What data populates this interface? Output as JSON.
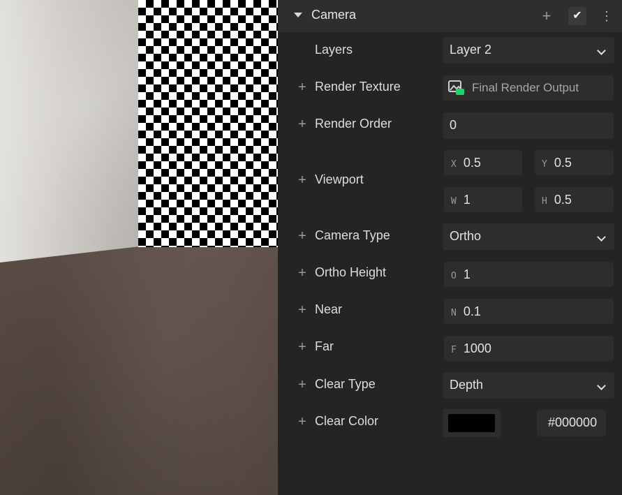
{
  "panel": {
    "title": "Camera",
    "header_plus": "+",
    "header_check": "✔",
    "header_more": "⋮",
    "fields": {
      "layers": {
        "label": "Layers",
        "value": "Layer 2"
      },
      "render_texture": {
        "label": "Render Texture",
        "value": "Final Render Output"
      },
      "render_order": {
        "label": "Render Order",
        "value": "0"
      },
      "viewport": {
        "label": "Viewport",
        "x": {
          "prefix": "X",
          "value": "0.5"
        },
        "y": {
          "prefix": "Y",
          "value": "0.5"
        },
        "w": {
          "prefix": "W",
          "value": "1"
        },
        "h": {
          "prefix": "H",
          "value": "0.5"
        }
      },
      "camera_type": {
        "label": "Camera Type",
        "value": "Ortho"
      },
      "ortho_height": {
        "label": "Ortho Height",
        "prefix": "O",
        "value": "1"
      },
      "near": {
        "label": "Near",
        "prefix": "N",
        "value": "0.1"
      },
      "far": {
        "label": "Far",
        "prefix": "F",
        "value": "1000"
      },
      "clear_type": {
        "label": "Clear Type",
        "value": "Depth"
      },
      "clear_color": {
        "label": "Clear Color",
        "hex": "#000000",
        "swatch_color": "#000000"
      }
    },
    "plus_glyph": "+"
  },
  "colors": {
    "panel_bg": "#242424",
    "header_bg": "#2e2e2e",
    "field_bg": "#2d2d2d",
    "text": "#dddddd",
    "muted_text": "#9a9a9a",
    "texture_icon_accent": "#1fd36b"
  }
}
